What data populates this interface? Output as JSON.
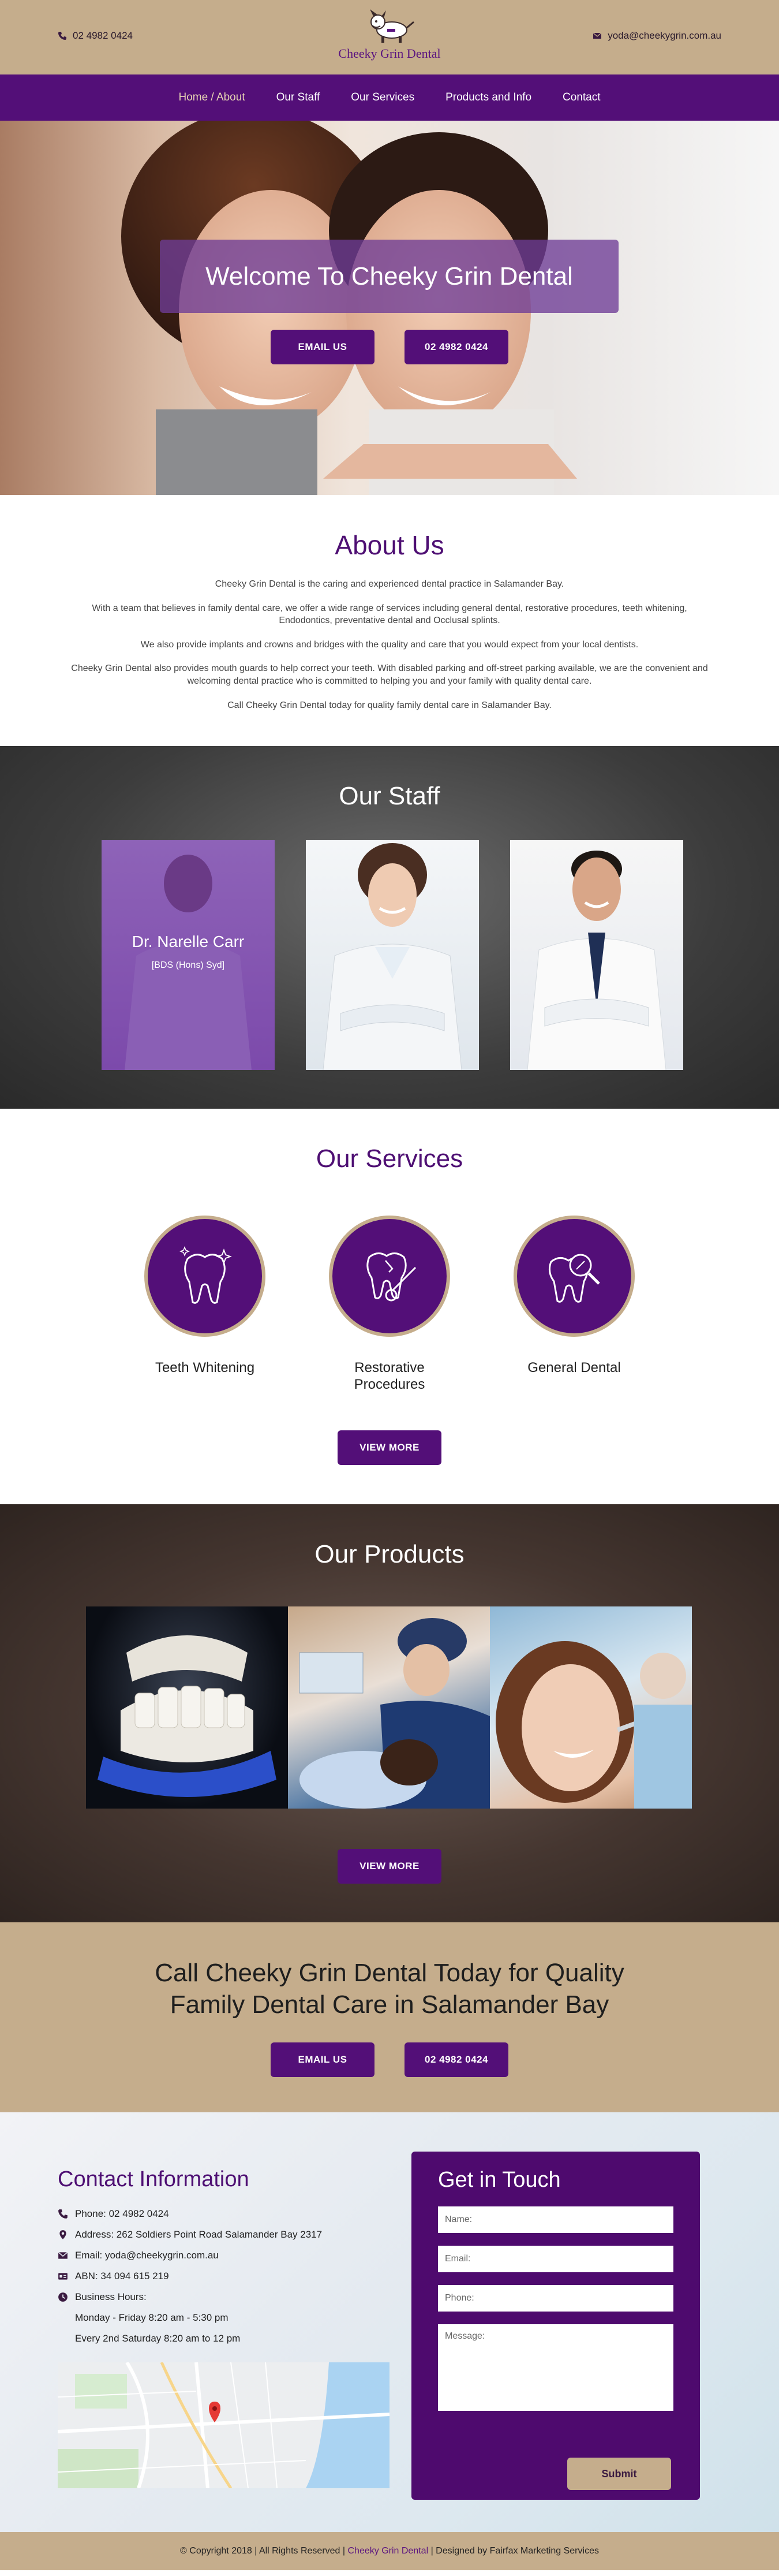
{
  "topbar": {
    "phone": "02 4982 0424",
    "email": "yoda@cheekygrin.com.au",
    "logo_text": "Cheeky Grin Dental"
  },
  "nav": {
    "items": [
      {
        "label": "Home / About",
        "active": true
      },
      {
        "label": "Our Staff"
      },
      {
        "label": "Our Services"
      },
      {
        "label": "Products and Info"
      },
      {
        "label": "Contact"
      }
    ]
  },
  "hero": {
    "title": "Welcome To Cheeky Grin Dental",
    "email_btn": "EMAIL US",
    "phone_btn": "02 4982 0424"
  },
  "about": {
    "title": "About Us",
    "paragraphs": [
      "Cheeky Grin Dental is the caring and experienced dental practice in Salamander Bay.",
      "With a team that believes in family dental care, we offer a wide range of services including general dental, restorative procedures, teeth whitening, Endodontics, preventative dental and Occlusal splints.",
      "We also provide implants and crowns and bridges with the quality and care that you would expect from your local dentists.",
      "Cheeky Grin Dental also provides mouth guards to help correct your teeth. With disabled parking and off-street parking available, we are the convenient and welcoming dental practice who is committed to helping you and your family with quality dental care.",
      "Call Cheeky Grin Dental today for quality family dental care in Salamander Bay."
    ]
  },
  "staff": {
    "title": "Our Staff",
    "members": [
      {
        "name": "Dr. Narelle Carr",
        "credentials": "[BDS (Hons) Syd]"
      }
    ]
  },
  "services": {
    "title": "Our Services",
    "items": [
      {
        "label": "Teeth Whitening",
        "icon": "tooth-sparkle-icon"
      },
      {
        "label": "Restorative Procedures",
        "icon": "tooth-mirror-icon"
      },
      {
        "label": "General Dental",
        "icon": "tooth-magnifier-icon"
      }
    ],
    "more_btn": "VIEW MORE"
  },
  "products": {
    "title": "Our Products",
    "more_btn": "VIEW MORE"
  },
  "cta": {
    "title_line1": "Call Cheeky Grin Dental Today for Quality",
    "title_line2": "Family Dental Care in Salamander Bay",
    "email_btn": "EMAIL US",
    "phone_btn": "02 4982 0424"
  },
  "contact": {
    "title": "Contact Information",
    "phone": "Phone: 02 4982 0424",
    "address": "Address: 262 Soldiers Point Road Salamander Bay 2317",
    "email": "Email: yoda@cheekygrin.com.au",
    "abn": "ABN: 34 094 615 219",
    "hours_label": "Business Hours:",
    "hours_weekday": "Monday - Friday 8:20 am - 5:30 pm",
    "hours_saturday": "Every 2nd Saturday 8:20 am to 12 pm"
  },
  "form": {
    "title": "Get in Touch",
    "name_placeholder": "Name:",
    "email_placeholder": "Email:",
    "phone_placeholder": "Phone:",
    "message_placeholder": "Message:",
    "submit": "Submit"
  },
  "footer": {
    "left": "© Copyright 2018 | All Rights Reserved |",
    "brand": "Cheeky Grin Dental",
    "right": "| Designed by Fairfax Marketing Services"
  },
  "colors": {
    "brand_purple": "#530f78",
    "tan": "#c5ad8c"
  }
}
